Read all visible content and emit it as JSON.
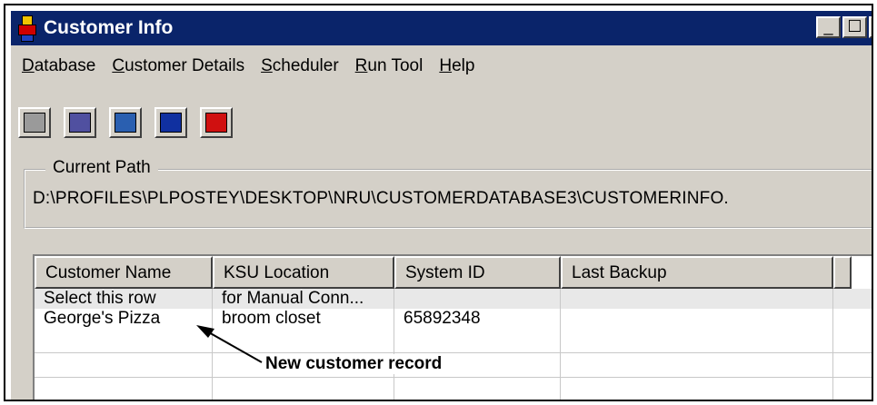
{
  "window": {
    "title": "Customer Info",
    "min_glyph": "_",
    "max_glyph": "☐",
    "close_glyph": "✕"
  },
  "menu": [
    {
      "accel": "D",
      "rest": "atabase"
    },
    {
      "accel": "C",
      "rest": "ustomer Details"
    },
    {
      "accel": "S",
      "rest": "cheduler"
    },
    {
      "accel": "R",
      "rest": "un Tool"
    },
    {
      "accel": "H",
      "rest": "elp"
    }
  ],
  "toolbar": {
    "buttons": [
      {
        "icon": "phone-icon",
        "color": "#9a9a9a"
      },
      {
        "icon": "customer-search-icon",
        "color": "#5050a0"
      },
      {
        "icon": "bridge-icon",
        "color": "#2a5fb0"
      },
      {
        "icon": "network-icon",
        "color": "#1030a0"
      },
      {
        "icon": "building-icon",
        "color": "#d01010"
      }
    ]
  },
  "current_path": {
    "label": "Current Path",
    "value": "D:\\PROFILES\\PLPOSTEY\\DESKTOP\\NRU\\CUSTOMERDATABASE3\\CUSTOMERINFO."
  },
  "table": {
    "columns": [
      "Customer Name",
      "KSU Location",
      "System ID",
      "Last Backup"
    ],
    "rows": [
      [
        "Select this row",
        "for Manual Conn...",
        "",
        ""
      ],
      [
        "George's Pizza",
        "broom closet",
        "65892348",
        ""
      ]
    ]
  },
  "annotation": {
    "text": "New customer record"
  }
}
